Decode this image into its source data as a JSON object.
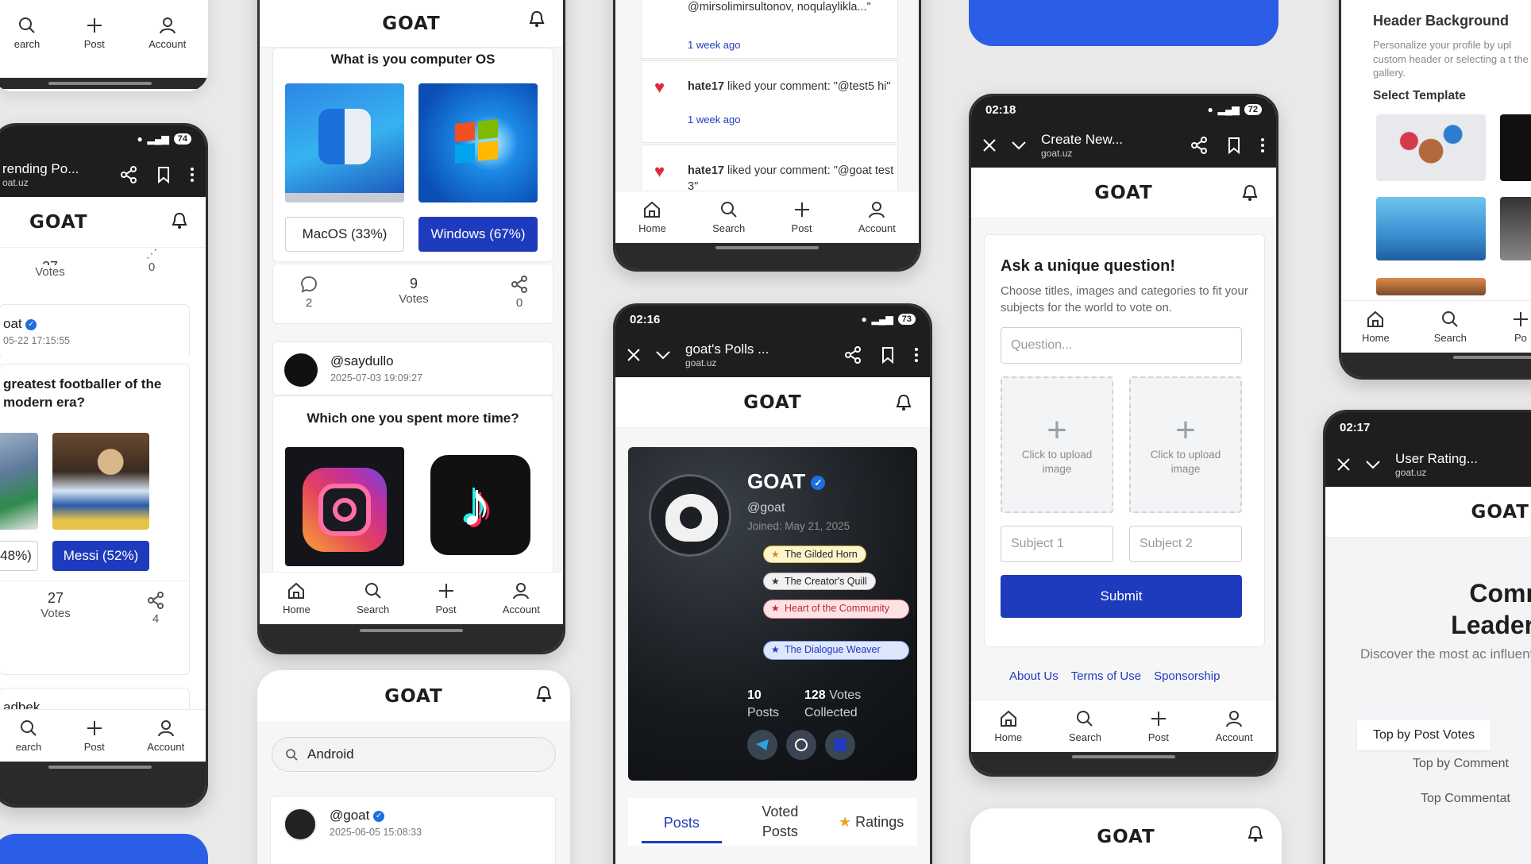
{
  "nav": {
    "home": "Home",
    "search": "Search",
    "search_clip": "earch",
    "post": "Post",
    "account": "Account",
    "post_clip": "Po"
  },
  "brand": "GOAT",
  "col1": {
    "status_batt": "74",
    "browser_title": "rending Po...",
    "browser_url": "oat.uz",
    "votes_top_count": "27",
    "votes_label": "Votes",
    "share_top": "0",
    "user": "oat",
    "date": "05-22 17:15:55",
    "question": "greatest footballer of the modern era?",
    "opt_left": "48%)",
    "opt_right": "Messi (52%)",
    "votes_count": "27",
    "share_count": "4",
    "next_user": "adbek"
  },
  "col2": {
    "question1": "What is you computer OS",
    "opt1": "MacOS (33%)",
    "opt2": "Windows (67%)",
    "comments": "2",
    "votes": "9",
    "votes_label": "Votes",
    "shares": "0",
    "user": "@saydullo",
    "user_date": "2025-07-03 19:09:27",
    "question2": "Which one you spent more time?",
    "search_value": "Android",
    "user2": "@goat",
    "user2_date": "2025-06-05 15:08:33"
  },
  "col3": {
    "n0_text": "@mirsolimirsultonov, noqulaylikla...\"",
    "n0_time": "1 week ago",
    "n1_user": "hate17",
    "n1_text": " liked your comment: \"@test5 hi\"",
    "n1_time": "1 week ago",
    "n2_user": "hate17",
    "n2_text": " liked your comment: \"@goat test 3\"",
    "status_time": "02:16",
    "status_batt": "73",
    "browser_title": "goat's Polls ...",
    "browser_url": "goat.uz",
    "profile_name": "GOAT",
    "profile_handle": "@goat",
    "joined": "Joined: May 21, 2025",
    "badges": [
      "The Gilded Horn",
      "The Creator's Quill",
      "Heart of the Community",
      "The Dialogue Weaver"
    ],
    "posts_count": "10",
    "posts_label": "Posts",
    "votes_count": "128",
    "votes_label": "Votes Collected",
    "tab_posts": "Posts",
    "tab_voted": "Voted Posts",
    "tab_ratings": "Ratings"
  },
  "col4": {
    "status_time": "02:18",
    "status_batt": "72",
    "browser_title": "Create New...",
    "browser_url": "goat.uz",
    "heading": "Ask a unique question!",
    "subtext": "Choose titles, images and categories to fit your subjects for the world to vote on.",
    "question_placeholder": "Question...",
    "upload_text": "Click to upload image",
    "subject1": "Subject 1",
    "subject2": "Subject 2",
    "submit": "Submit",
    "link_about": "About Us",
    "link_terms": "Terms of Use",
    "link_sponsor": "Sponsorship"
  },
  "col5": {
    "header_bg_title": "Header Background",
    "header_bg_text": "Personalize your profile by upl custom header or selecting a t the gallery.",
    "select_template": "Select Template",
    "status_time": "02:17",
    "browser_title": "User Rating...",
    "browser_url": "goat.uz",
    "leader_title1": "Commun",
    "leader_title2": "Leaderboa",
    "leader_sub": "Discover the most ac influential users in our c",
    "tab1": "Top by Post Votes",
    "tab2": "Top by Comment",
    "tab3": "Top Commentat"
  },
  "colors": {
    "accent": "#1f3bbd",
    "dark": "#1e1e1e",
    "heart": "#e0283e"
  }
}
